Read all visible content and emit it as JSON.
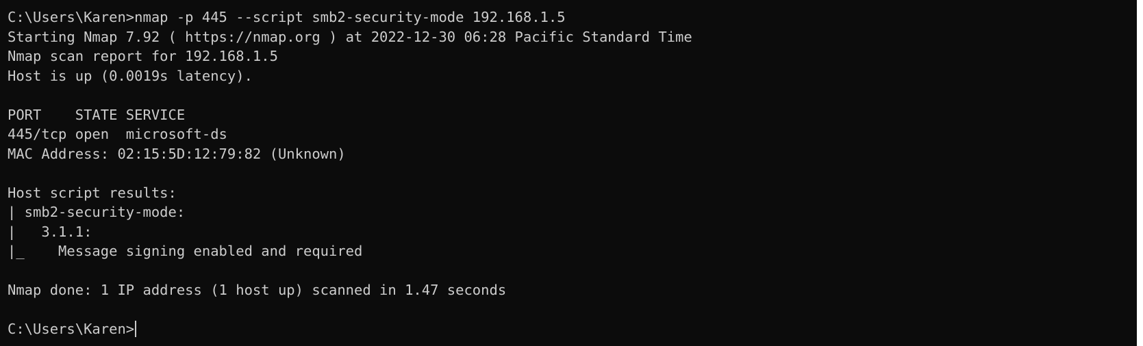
{
  "terminal": {
    "lines": [
      "C:\\Users\\Karen>nmap -p 445 --script smb2-security-mode 192.168.1.5",
      "Starting Nmap 7.92 ( https://nmap.org ) at 2022-12-30 06:28 Pacific Standard Time",
      "Nmap scan report for 192.168.1.5",
      "Host is up (0.0019s latency).",
      "",
      "PORT    STATE SERVICE",
      "445/tcp open  microsoft-ds",
      "MAC Address: 02:15:5D:12:79:82 (Unknown)",
      "",
      "Host script results:",
      "| smb2-security-mode:",
      "|   3.1.1:",
      "|_    Message signing enabled and required",
      "",
      "Nmap done: 1 IP address (1 host up) scanned in 1.47 seconds",
      ""
    ],
    "prompt": "C:\\Users\\Karen>",
    "colors": {
      "background": "#0c0c0c",
      "foreground": "#cccccc"
    }
  }
}
